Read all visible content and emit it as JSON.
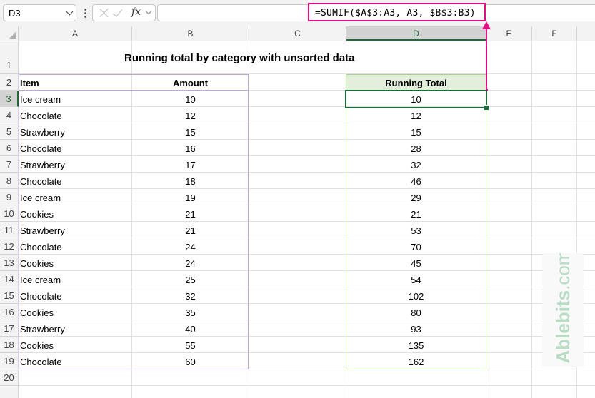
{
  "formula_bar": {
    "name_box": "D3",
    "fx_label": "fx",
    "formula": "=SUMIF($A$3:A3, A3, $B$3:B3)"
  },
  "columns": [
    "A",
    "B",
    "C",
    "D",
    "E",
    "F"
  ],
  "rows": [
    "1",
    "2",
    "3",
    "4",
    "5",
    "6",
    "7",
    "8",
    "9",
    "10",
    "11",
    "12",
    "13",
    "14",
    "15",
    "16",
    "17",
    "18",
    "19",
    "20"
  ],
  "sheet": {
    "title": "Running total by category with unsorted data",
    "header_item": "Item",
    "header_amount": "Amount",
    "header_running_total": "Running Total",
    "data": [
      {
        "item": "Ice cream",
        "amount": "10",
        "running_total": "10"
      },
      {
        "item": "Chocolate",
        "amount": "12",
        "running_total": "12"
      },
      {
        "item": "Strawberry",
        "amount": "15",
        "running_total": "15"
      },
      {
        "item": "Chocolate",
        "amount": "16",
        "running_total": "28"
      },
      {
        "item": "Strawberry",
        "amount": "17",
        "running_total": "32"
      },
      {
        "item": "Chocolate",
        "amount": "18",
        "running_total": "46"
      },
      {
        "item": "Ice cream",
        "amount": "19",
        "running_total": "29"
      },
      {
        "item": "Cookies",
        "amount": "21",
        "running_total": "21"
      },
      {
        "item": "Strawberry",
        "amount": "21",
        "running_total": "53"
      },
      {
        "item": "Chocolate",
        "amount": "24",
        "running_total": "70"
      },
      {
        "item": "Cookies",
        "amount": "24",
        "running_total": "45"
      },
      {
        "item": "Ice cream",
        "amount": "25",
        "running_total": "54"
      },
      {
        "item": "Chocolate",
        "amount": "32",
        "running_total": "102"
      },
      {
        "item": "Cookies",
        "amount": "35",
        "running_total": "80"
      },
      {
        "item": "Strawberry",
        "amount": "40",
        "running_total": "93"
      },
      {
        "item": "Cookies",
        "amount": "55",
        "running_total": "135"
      },
      {
        "item": "Chocolate",
        "amount": "60",
        "running_total": "162"
      }
    ]
  },
  "watermark": {
    "brand": "Ablebits",
    "suffix": ".com"
  },
  "colors": {
    "highlight": "#e20f84",
    "selection": "#1e6b3a",
    "table_header_fill": "#e2efda"
  }
}
